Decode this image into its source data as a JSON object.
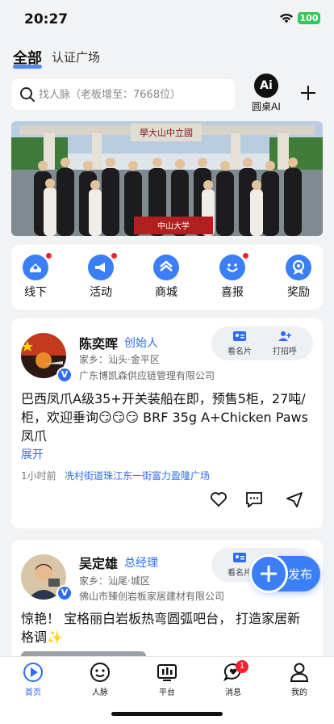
{
  "status_bar": {
    "time": "20:27",
    "battery": "100"
  },
  "top_tabs": {
    "active": "全部",
    "other": "认证广场"
  },
  "search": {
    "placeholder": "找人脉（老板增至：7668位）",
    "ai_logo": "Ai",
    "ai_label": "圆桌AI"
  },
  "banner": {
    "gate_sign": "學大山中立國",
    "banner_text": "中山大学"
  },
  "quick_menu": [
    {
      "label": "线下",
      "icon": "meeting-icon",
      "badge": true
    },
    {
      "label": "活动",
      "icon": "megaphone-icon",
      "badge": true
    },
    {
      "label": "商城",
      "icon": "store-icon",
      "badge": false
    },
    {
      "label": "喜报",
      "icon": "smile-icon",
      "badge": true
    },
    {
      "label": "奖励",
      "icon": "award-icon",
      "badge": false
    }
  ],
  "posts": [
    {
      "name": "陈奕晖",
      "title": "创始人",
      "hometown": "家乡：汕头·金平区",
      "company": "广东博凯森供应链管理有限公司",
      "badge": "V",
      "content": "巴西凤爪A级35+开关装船在即，预售5柜，27吨/柜，欢迎垂询😏😏😏 BRF 35g A+Chicken Paws凤爪",
      "expand": "展开",
      "time": "1小时前",
      "location": "冼村街道珠江东一街富力盈隆广场",
      "card_action": "看名片",
      "greet_action": "打招呼"
    },
    {
      "name": "吴定雄",
      "title": "总经理",
      "hometown": "家乡：汕尾·城区",
      "company": "佛山市臻创岩板家居建材有限公司",
      "badge": "V",
      "content": "惊艳！ 宝格丽白岩板热弯圆弧吧台， 打造家居新格调✨",
      "card_action": "看名片"
    }
  ],
  "publish": {
    "label": "发布"
  },
  "bottom_nav": [
    {
      "label": "首页",
      "icon": "home-play-icon",
      "active": true
    },
    {
      "label": "人脉",
      "icon": "contacts-icon"
    },
    {
      "label": "平台",
      "icon": "platform-icon"
    },
    {
      "label": "消息",
      "icon": "message-icon",
      "badge": "1"
    },
    {
      "label": "我的",
      "icon": "profile-icon"
    }
  ],
  "colors": {
    "accent": "#2d6cf6",
    "badge_red": "#f5222d",
    "battery_green": "#34c759"
  }
}
